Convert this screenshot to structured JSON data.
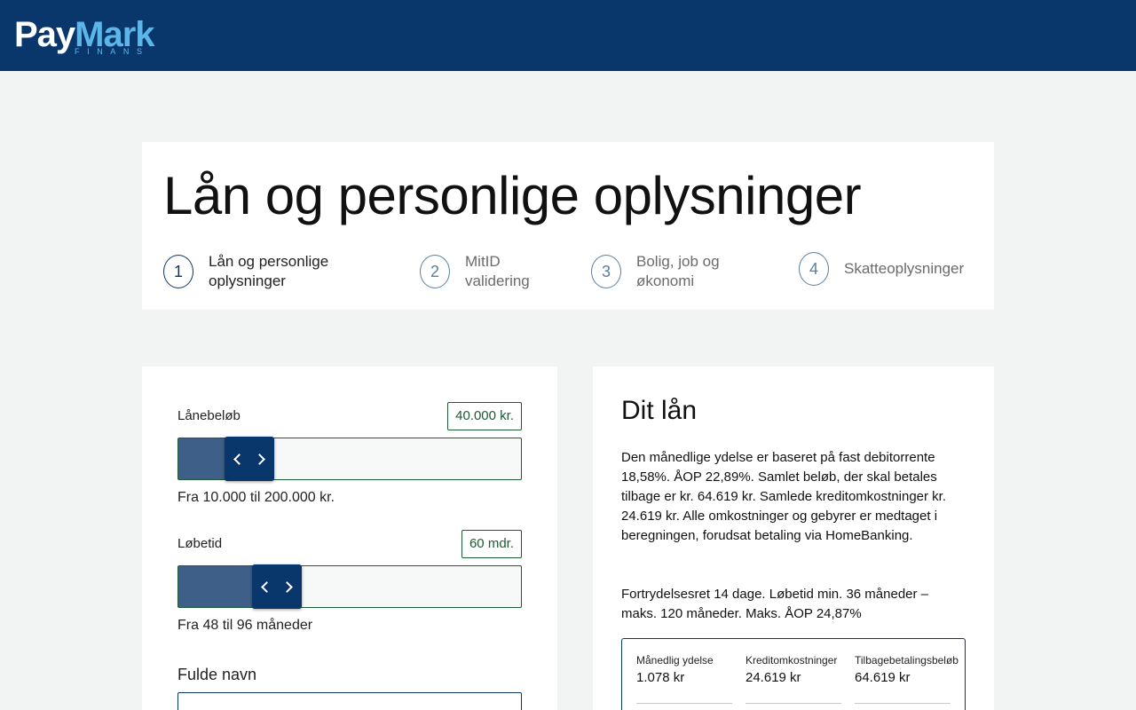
{
  "brand": {
    "name_part1": "Pay",
    "name_part2": "Mark",
    "tagline": "FINANS"
  },
  "page_title": "Lån og personlige oplysninger",
  "steps": [
    {
      "number": "1",
      "label": "Lån og personlige oplysninger",
      "active": true
    },
    {
      "number": "2",
      "label": "MitID validering",
      "active": false
    },
    {
      "number": "3",
      "label": "Bolig, job og økonomi",
      "active": false
    },
    {
      "number": "4",
      "label": "Skatteoplysninger",
      "active": false
    }
  ],
  "loan_form": {
    "amount": {
      "label": "Lånebeløb",
      "value": "40.000 kr.",
      "range_text": "Fra 10.000 til 200.000 kr.",
      "slider_fraction": 0.158
    },
    "term": {
      "label": "Løbetid",
      "value": "60 mdr.",
      "range_text": "Fra 48 til 96 måneder",
      "slider_fraction": 0.25
    },
    "full_name": {
      "label": "Fulde navn",
      "value": ""
    }
  },
  "summary": {
    "title": "Dit lån",
    "paragraph1": "Den månedlige ydelse er baseret på fast debitorrente 18,58%. ÅOP 22,89%. Samlet beløb, der skal betales tilbage er kr. 64.619 kr. Samlede kreditomkostninger kr. 24.619 kr. Alle omkostninger og gebyrer er medtaget i beregningen, forudsat betaling via HomeBanking.",
    "paragraph2": "Fortrydelsesret 14 dage. Løbetid min. 36 måneder – maks. 120 måneder. Maks. ÅOP 24,87%",
    "stats": [
      {
        "label": "Månedlig ydelse",
        "value": "1.078 kr"
      },
      {
        "label": "Kreditomkostninger",
        "value": "24.619 kr"
      },
      {
        "label": "Tilbagebetalingsbeløb",
        "value": "64.619 kr"
      }
    ]
  },
  "colors": {
    "header_bg": "#0a376b",
    "brand_accent": "#5bb7ea",
    "slider_fill": "#3e6088",
    "badge_border": "#1f5a32"
  }
}
